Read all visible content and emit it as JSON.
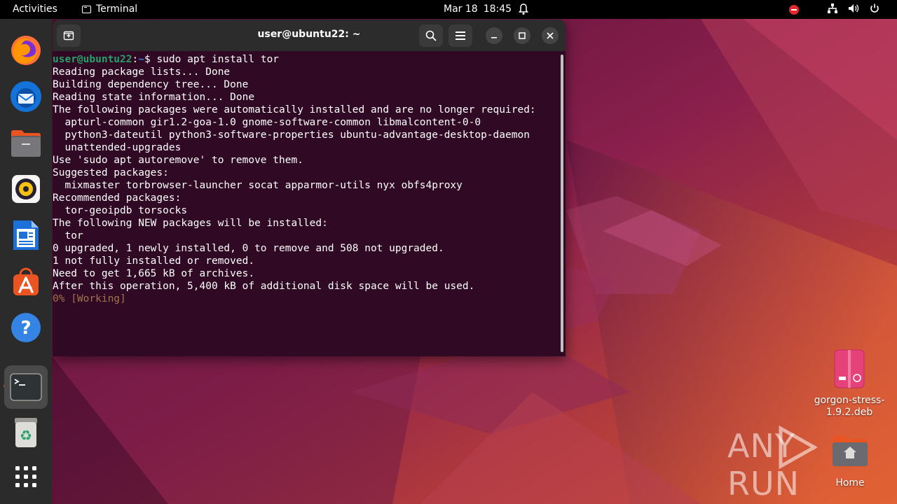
{
  "topbar": {
    "activities": "Activities",
    "app_name": "Terminal",
    "date": "Mar 18",
    "time": "18:45",
    "icons": [
      "notification-bell-icon",
      "do-not-disturb-icon",
      "network-icon",
      "volume-icon",
      "power-icon"
    ]
  },
  "dock": {
    "items": [
      {
        "name": "firefox",
        "icon": "firefox-icon"
      },
      {
        "name": "thunderbird",
        "icon": "thunderbird-icon"
      },
      {
        "name": "files",
        "icon": "files-icon"
      },
      {
        "name": "rhythmbox",
        "icon": "rhythmbox-icon"
      },
      {
        "name": "libreoffice-writer",
        "icon": "writer-icon"
      },
      {
        "name": "ubuntu-software",
        "icon": "software-icon"
      },
      {
        "name": "help",
        "icon": "help-icon"
      },
      {
        "name": "terminal",
        "icon": "terminal-icon",
        "active": true
      },
      {
        "name": "trash",
        "icon": "trash-icon"
      },
      {
        "name": "show-applications",
        "icon": "app-grid-icon"
      }
    ]
  },
  "window": {
    "title": "user@ubuntu22: ~",
    "prompt_user": "user@ubuntu22",
    "prompt_sep": ":",
    "prompt_path": "~",
    "prompt_symbol": "$ ",
    "command": "sudo apt install tor",
    "output_lines": [
      "Reading package lists... Done",
      "Building dependency tree... Done",
      "Reading state information... Done",
      "The following packages were automatically installed and are no longer required:",
      "  apturl-common gir1.2-goa-1.0 gnome-software-common libmalcontent-0-0",
      "  python3-dateutil python3-software-properties ubuntu-advantage-desktop-daemon",
      "  unattended-upgrades",
      "Use 'sudo apt autoremove' to remove them.",
      "Suggested packages:",
      "  mixmaster torbrowser-launcher socat apparmor-utils nyx obfs4proxy",
      "Recommended packages:",
      "  tor-geoipdb torsocks",
      "The following NEW packages will be installed:",
      "  tor",
      "0 upgraded, 1 newly installed, 0 to remove and 508 not upgraded.",
      "1 not fully installed or removed.",
      "Need to get 1,665 kB of archives.",
      "After this operation, 5,400 kB of additional disk space will be used."
    ],
    "progress_line": "0% [Working]"
  },
  "desktop": {
    "deb_file_label": "gorgon-stress-1.9.2.deb",
    "home_label": "Home",
    "watermark": "ANY RUN"
  },
  "colors": {
    "terminal_bg": "#300a24",
    "prompt_user": "#26a269",
    "prompt_path": "#3584e4",
    "accent": "#e95420"
  }
}
